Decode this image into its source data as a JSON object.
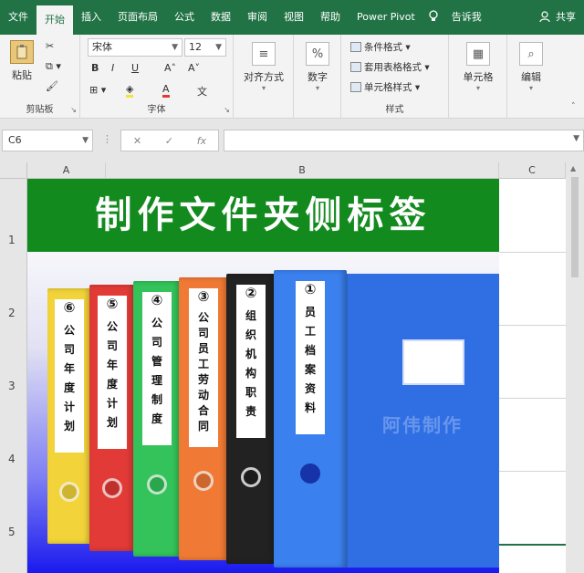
{
  "tabs": [
    "文件",
    "开始",
    "插入",
    "页面布局",
    "公式",
    "数据",
    "审阅",
    "视图",
    "帮助",
    "Power Pivot",
    "告诉我",
    "共享"
  ],
  "ribbon": {
    "clipboard": {
      "paste": "粘贴",
      "label": "剪贴板"
    },
    "font": {
      "name": "宋体",
      "size": "12",
      "label": "字体",
      "bold": "B",
      "italic": "I",
      "underline": "U",
      "grow": "A˄",
      "shrink": "A˅",
      "font_color": "A",
      "phonetic": "文"
    },
    "alignment": {
      "label": "对齐方式"
    },
    "number": {
      "label": "数字",
      "icon_text": "%"
    },
    "styles": {
      "conditional": "条件格式",
      "table_format": "套用表格格式",
      "cell_style": "单元格样式",
      "label": "样式"
    },
    "cells": {
      "label": "单元格"
    },
    "editing": {
      "label": "编辑"
    }
  },
  "formula_bar": {
    "name_box": "C6",
    "cancel": "✕",
    "enter": "✓",
    "fx": "fx",
    "value": ""
  },
  "columns": [
    "A",
    "B",
    "C"
  ],
  "rows": [
    "1",
    "2",
    "3",
    "4",
    "5"
  ],
  "banner": {
    "title": "制作文件夹侧标签"
  },
  "binders": [
    {
      "num": "⑥",
      "chars": [
        "公",
        "司",
        "年",
        "度",
        "计",
        "划"
      ],
      "color": "#f2d43a"
    },
    {
      "num": "⑤",
      "chars": [
        "公",
        "司",
        "年",
        "度",
        "计",
        "划"
      ],
      "color": "#e23a36"
    },
    {
      "num": "④",
      "chars": [
        "公",
        "司",
        "管",
        "理",
        "制",
        "度"
      ],
      "color": "#33c35a"
    },
    {
      "num": "③",
      "chars": [
        "公",
        "司",
        "员",
        "工",
        "劳",
        "动",
        "合",
        "同"
      ],
      "color": "#f07a35"
    },
    {
      "num": "②",
      "chars": [
        "组",
        "织",
        "机",
        "构",
        "职",
        "责"
      ],
      "color": "#222222"
    },
    {
      "num": "①",
      "chars": [
        "员",
        "工",
        "档",
        "案",
        "资",
        "料"
      ],
      "color": "#3a80ef"
    }
  ],
  "watermark": "阿伟制作"
}
